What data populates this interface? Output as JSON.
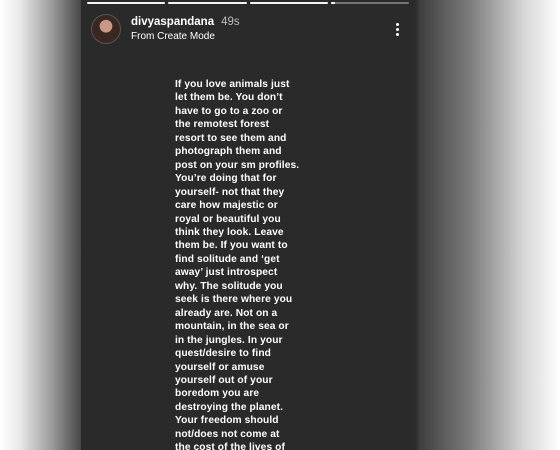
{
  "story": {
    "username": "divyaspandana",
    "time": "49s",
    "subtitle": "From Create Mode",
    "progress_fraction": 0.06,
    "text": "If you love animals just\nlet them be. You don’t\nhave to go to a zoo or\nthe remotest forest\nresort to see them and\nphotograph them and\npost on your sm profiles.\nYou’re doing that for\nyourself- not that they\ncare how majestic or\nroyal or beautiful you\nthink they look. Leave\nthem be. If you want to\nfind solitude and ‘get\naway’ just introspect\nwhy. The solitude you\nseek is there where you\nalready are. Not on a\nmountain, in the sea or\nin the jungles. In your\nquest/desire to find\nyourself or amuse\nyourself out of your\nboredom  you are\ndestroying the planet.\nYour freedom should\nnot/does not come at\nthe cost of the lives of\nother beings."
  },
  "icons": {
    "avatar": "profile-avatar",
    "menu": "more-vertical-icon"
  }
}
